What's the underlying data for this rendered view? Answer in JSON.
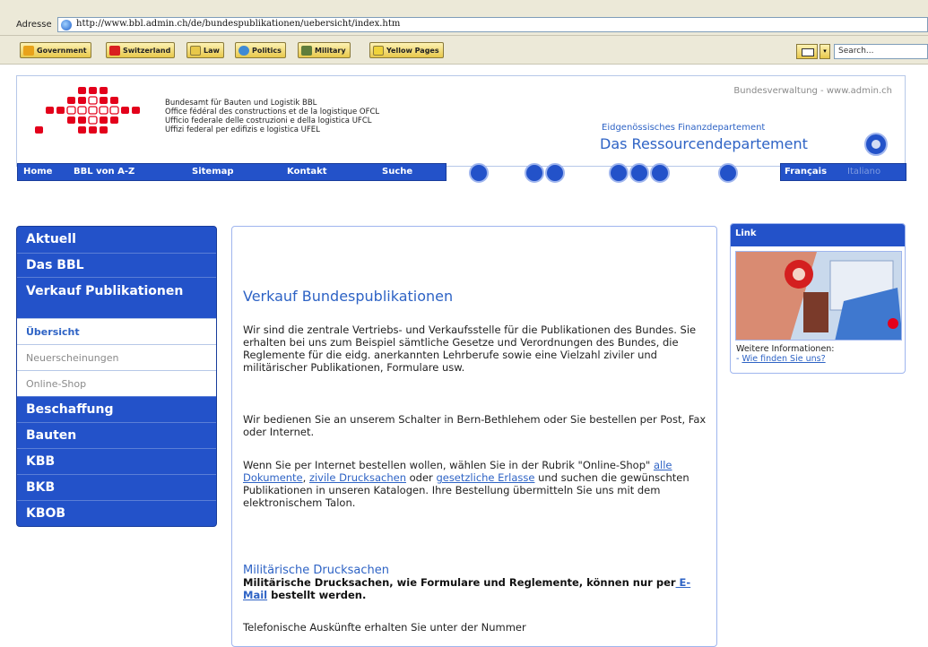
{
  "browser": {
    "address_label": "Adresse",
    "url": "http://www.bbl.admin.ch/de/bundespublikationen/uebersicht/index.htm",
    "links": [
      {
        "label": "Government",
        "color": "#e8a21a"
      },
      {
        "label": "Switzerland",
        "color": "#d91f1f"
      },
      {
        "label": "Law",
        "color": "#e8c84a"
      },
      {
        "label": "Politics",
        "color": "#3f8ad4"
      },
      {
        "label": "Military",
        "color": "#5f7d3a"
      },
      {
        "label": "Yellow Pages",
        "color": "#f0d33a"
      }
    ],
    "search_placeholder": "Search..."
  },
  "header": {
    "agency_lines": [
      "Bundesamt für Bauten und Logistik BBL",
      "Office fédéral des constructions et de la logistique OFCL",
      "Ufficio federale delle costruzioni e della logistica UFCL",
      "Uffizi federal per edifizis e logistica UFEL"
    ],
    "bundesverwaltung": "Bundesverwaltung - www.admin.ch",
    "department_small": "Eidgenössisches Finanzdepartement",
    "department_big": "Das Ressourcendepartement",
    "nav": [
      "Home",
      "BBL von A-Z",
      "Sitemap",
      "Kontakt",
      "Suche"
    ],
    "lang_active": "Français",
    "lang_inactive": "Italiano",
    "brand_red": "#e3001b",
    "brand_blue": "#2352c9"
  },
  "sidebar": {
    "items": [
      {
        "label": "Aktuell"
      },
      {
        "label": "Das BBL"
      },
      {
        "label": "Verkauf Publikationen"
      },
      {
        "label": "Beschaffung"
      },
      {
        "label": "Bauten"
      },
      {
        "label": "KBB"
      },
      {
        "label": "BKB"
      },
      {
        "label": "KBOB"
      }
    ],
    "subitems": [
      {
        "label": "Übersicht",
        "active": true
      },
      {
        "label": "Neuerscheinungen"
      },
      {
        "label": "Online-Shop"
      }
    ]
  },
  "main": {
    "title": "Verkauf Bundespublikationen",
    "p1": "Wir sind die zentrale Vertriebs- und Verkaufsstelle für die Publikationen des Bundes. Sie erhalten bei uns zum Beispiel sämtliche Gesetze und Verordnungen des Bundes, die Reglemente für die eidg. anerkannten Lehrberufe sowie eine Vielzahl ziviler und militärischer Publikationen, Formulare usw.",
    "p2": "Wir bedienen Sie an unserem Schalter in Bern-Bethlehem oder Sie bestellen per Post, Fax oder Internet.",
    "p3_prefix": "Wenn Sie per Internet bestellen wollen, wählen Sie in der Rubrik \"Online-Shop\" ",
    "p3_link1": "alle Dokumente",
    "p3_sep": ", ",
    "p3_link2": "zivile Drucksachen",
    "p3_or": " oder ",
    "p3_link3": "gesetzliche Erlasse",
    "p3_suffix": " und suchen die gewünschten Publikationen in unseren Katalogen. Ihre Bestellung übermitteln Sie uns mit dem elektronischem Talon.",
    "mil_title": "Militärische Drucksachen",
    "mil_prefix": "Militärische Drucksachen, wie Formulare und Reglemente, können nur per",
    "mil_link": " E-Mail",
    "mil_suffix": " bestellt werden.",
    "p4": "Telefonische Auskünfte erhalten Sie unter der Nummer"
  },
  "rightbox": {
    "title": "Link",
    "text": "Weitere Informationen:",
    "link_prefix": "- ",
    "link": "Wie finden Sie uns?"
  }
}
